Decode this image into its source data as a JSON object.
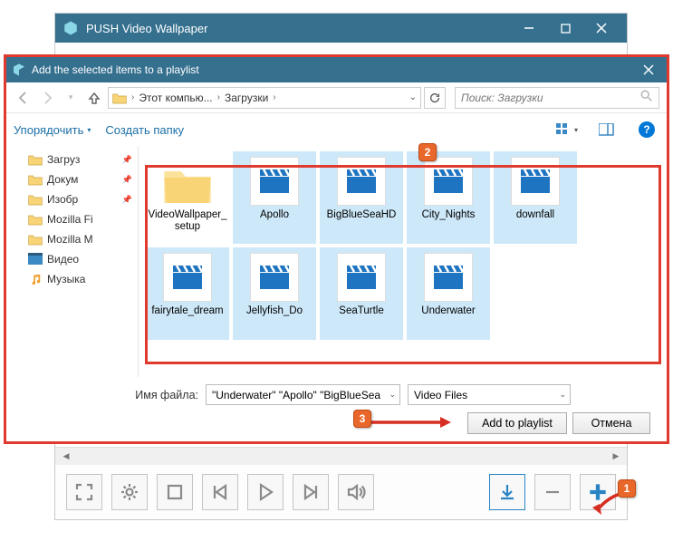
{
  "bgWindow": {
    "title": "PUSH Video Wallpaper"
  },
  "dialog": {
    "title": "Add the selected items to a playlist",
    "breadcrumb": {
      "seg1": "Этот компью...",
      "seg2": "Загрузки"
    },
    "searchPlaceholder": "Поиск: Загрузки",
    "organize": "Упорядочить",
    "newFolder": "Создать папку"
  },
  "sidebar": {
    "items": [
      {
        "label": "Загруз",
        "type": "folder",
        "pinned": true
      },
      {
        "label": "Докум",
        "type": "folder",
        "pinned": true
      },
      {
        "label": "Изобр",
        "type": "folder",
        "pinned": true
      },
      {
        "label": "Mozilla Fi",
        "type": "folder",
        "pinned": false
      },
      {
        "label": "Mozilla M",
        "type": "folder",
        "pinned": false
      },
      {
        "label": "Видео",
        "type": "video",
        "pinned": false
      },
      {
        "label": "Музыка",
        "type": "music",
        "pinned": false
      }
    ]
  },
  "files": [
    {
      "name": "VideoWallpaper_setup",
      "type": "folder",
      "selected": false
    },
    {
      "name": "Apollo",
      "type": "video",
      "selected": true
    },
    {
      "name": "BigBlueSeaHD",
      "type": "video",
      "selected": true
    },
    {
      "name": "City_Nights",
      "type": "video",
      "selected": true
    },
    {
      "name": "downfall",
      "type": "video",
      "selected": true
    },
    {
      "name": "fairytale_dream",
      "type": "video",
      "selected": true
    },
    {
      "name": "Jellyfish_Do",
      "type": "video",
      "selected": true
    },
    {
      "name": "SeaTurtle",
      "type": "video",
      "selected": true
    },
    {
      "name": "Underwater",
      "type": "video",
      "selected": true
    }
  ],
  "footer": {
    "fileNameLabel": "Имя файла:",
    "fileNameValue": "\"Underwater\" \"Apollo\" \"BigBlueSea",
    "fileTypeValue": "Video Files",
    "addBtn": "Add to playlist",
    "cancelBtn": "Отмена"
  },
  "annotations": {
    "b1": "1",
    "b2": "2",
    "b3": "3"
  }
}
